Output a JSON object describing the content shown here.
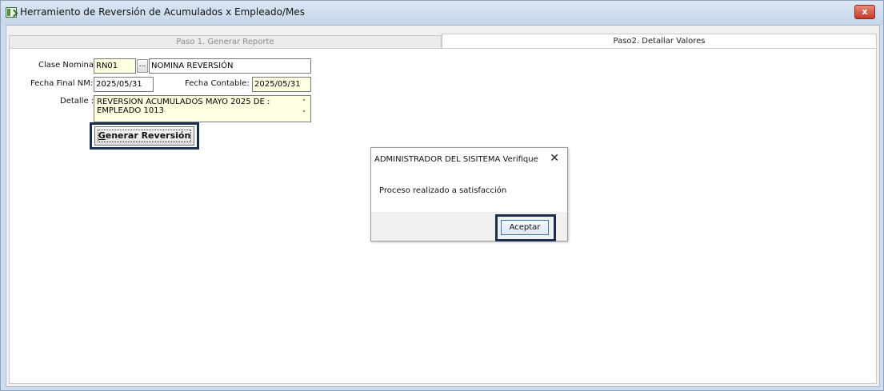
{
  "window": {
    "title": "Herramiento de Reversión de Acumulados x Empleado/Mes",
    "close_label": "x"
  },
  "tabs": [
    {
      "label": "Paso 1. Generar Reporte",
      "active": false
    },
    {
      "label": "Paso2. Detallar Valores",
      "active": true
    }
  ],
  "form": {
    "clase_nomina_label": "Clase Nomina :",
    "clase_nomina_code": "RN01",
    "browse_label": "...",
    "clase_nomina_desc": "NOMINA REVERSIÓN",
    "fecha_final_label": "Fecha Final  NM:",
    "fecha_final_value": "2025/05/31",
    "fecha_contable_label": "Fecha Contable:",
    "fecha_contable_value": "2025/05/31",
    "detalle_label": "Detalle :",
    "detalle_line1": "REVERSION ACUMULADOS MAYO  2025 DE :",
    "detalle_line2": "EMPLEADO 1013",
    "generate_button_underlined": "G",
    "generate_button_rest": "enerar Reversión"
  },
  "dialog": {
    "title": "ADMINISTRADOR DEL SISITEMA Verifique",
    "close_label": "✕",
    "message": "Proceso realizado a satisfacción",
    "ok_label": "Aceptar"
  },
  "colors": {
    "field_yellow": "#ffffe1",
    "highlight_border": "#1c2d4d",
    "close_red": "#c43b26"
  }
}
